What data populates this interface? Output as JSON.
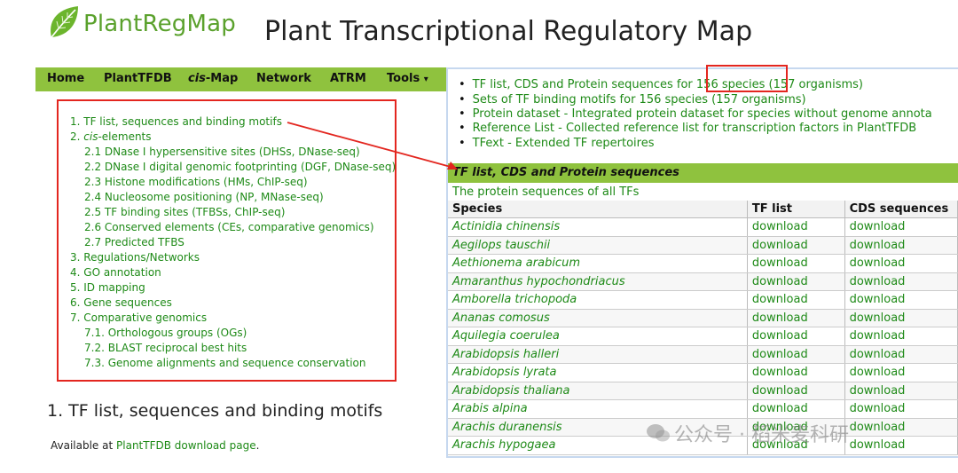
{
  "header": {
    "logo_text": "PlantRegMap",
    "site_title": "Plant Transcriptional Regulatory Map"
  },
  "nav": {
    "home": "Home",
    "plantTFDB": "PlantTFDB",
    "cis_prefix": "cis",
    "cis_suffix": "-Map",
    "network": "Network",
    "atrm": "ATRM",
    "tools": "Tools",
    "tools_caret": "▾"
  },
  "toc": {
    "items": [
      "1. TF list, sequences and binding motifs",
      "2. ",
      "2.1 DNase I hypersensitive sites (DHSs, DNase-seq)",
      "2.2 DNase I digital genomic footprinting (DGF, DNase-seq)",
      "2.3 Histone modifications (HMs, ChIP-seq)",
      "2.4 Nucleosome positioning (NP, MNase-seq)",
      "2.5 TF binding sites (TFBSs, ChIP-seq)",
      "2.6 Conserved elements (CEs, comparative genomics)",
      "2.7 Predicted TFBS",
      "3. Regulations/Networks",
      "4. GO annotation",
      "5. ID mapping",
      "6. Gene sequences",
      "7. Comparative genomics",
      "7.1. Orthologous groups (OGs)",
      "7.2. BLAST reciprocal best hits",
      "7.3. Genome alignments and sequence conservation"
    ],
    "item2_italic": "cis",
    "item2_rest": "-elements"
  },
  "section_heading": "1. TF list, sequences and binding motifs",
  "available": {
    "prefix": "Available at ",
    "link": "PlantTFDB download page",
    "suffix": "."
  },
  "panel": {
    "bullets": [
      {
        "a": "TF list, CDS and Protein sequences for ",
        "b": "156 species",
        "c": " (157 organisms)"
      },
      {
        "a": "Sets of TF binding motifs for 156 species (157 organisms)",
        "b": "",
        "c": ""
      },
      {
        "a": "Protein dataset - Integrated protein dataset for species without genome annota",
        "b": "",
        "c": ""
      },
      {
        "a": "Reference List - Collected reference list for transcription factors in PlantTFDB",
        "b": "",
        "c": ""
      },
      {
        "a": "TFext - Extended TF repertoires",
        "b": "",
        "c": ""
      }
    ],
    "table_title": "TF list, CDS and Protein sequences",
    "subtitle": "The protein sequences of all TFs",
    "columns": [
      "Species",
      "TF list",
      "CDS sequences"
    ],
    "rows": [
      [
        "Actinidia chinensis",
        "download",
        "download"
      ],
      [
        "Aegilops tauschii",
        "download",
        "download"
      ],
      [
        "Aethionema arabicum",
        "download",
        "download"
      ],
      [
        "Amaranthus hypochondriacus",
        "download",
        "download"
      ],
      [
        "Amborella trichopoda",
        "download",
        "download"
      ],
      [
        "Ananas comosus",
        "download",
        "download"
      ],
      [
        "Aquilegia coerulea",
        "download",
        "download"
      ],
      [
        "Arabidopsis halleri",
        "download",
        "download"
      ],
      [
        "Arabidopsis lyrata",
        "download",
        "download"
      ],
      [
        "Arabidopsis thaliana",
        "download",
        "download"
      ],
      [
        "Arabis alpina",
        "download",
        "download"
      ],
      [
        "Arachis duranensis",
        "download",
        "download"
      ],
      [
        "Arachis hypogaea",
        "download",
        "download"
      ]
    ]
  },
  "watermark": "公众号 · 稻米麦科研",
  "colors": {
    "accent_green": "#8fc23e",
    "link_green": "#1e8a17",
    "highlight_red": "#e3261f"
  }
}
